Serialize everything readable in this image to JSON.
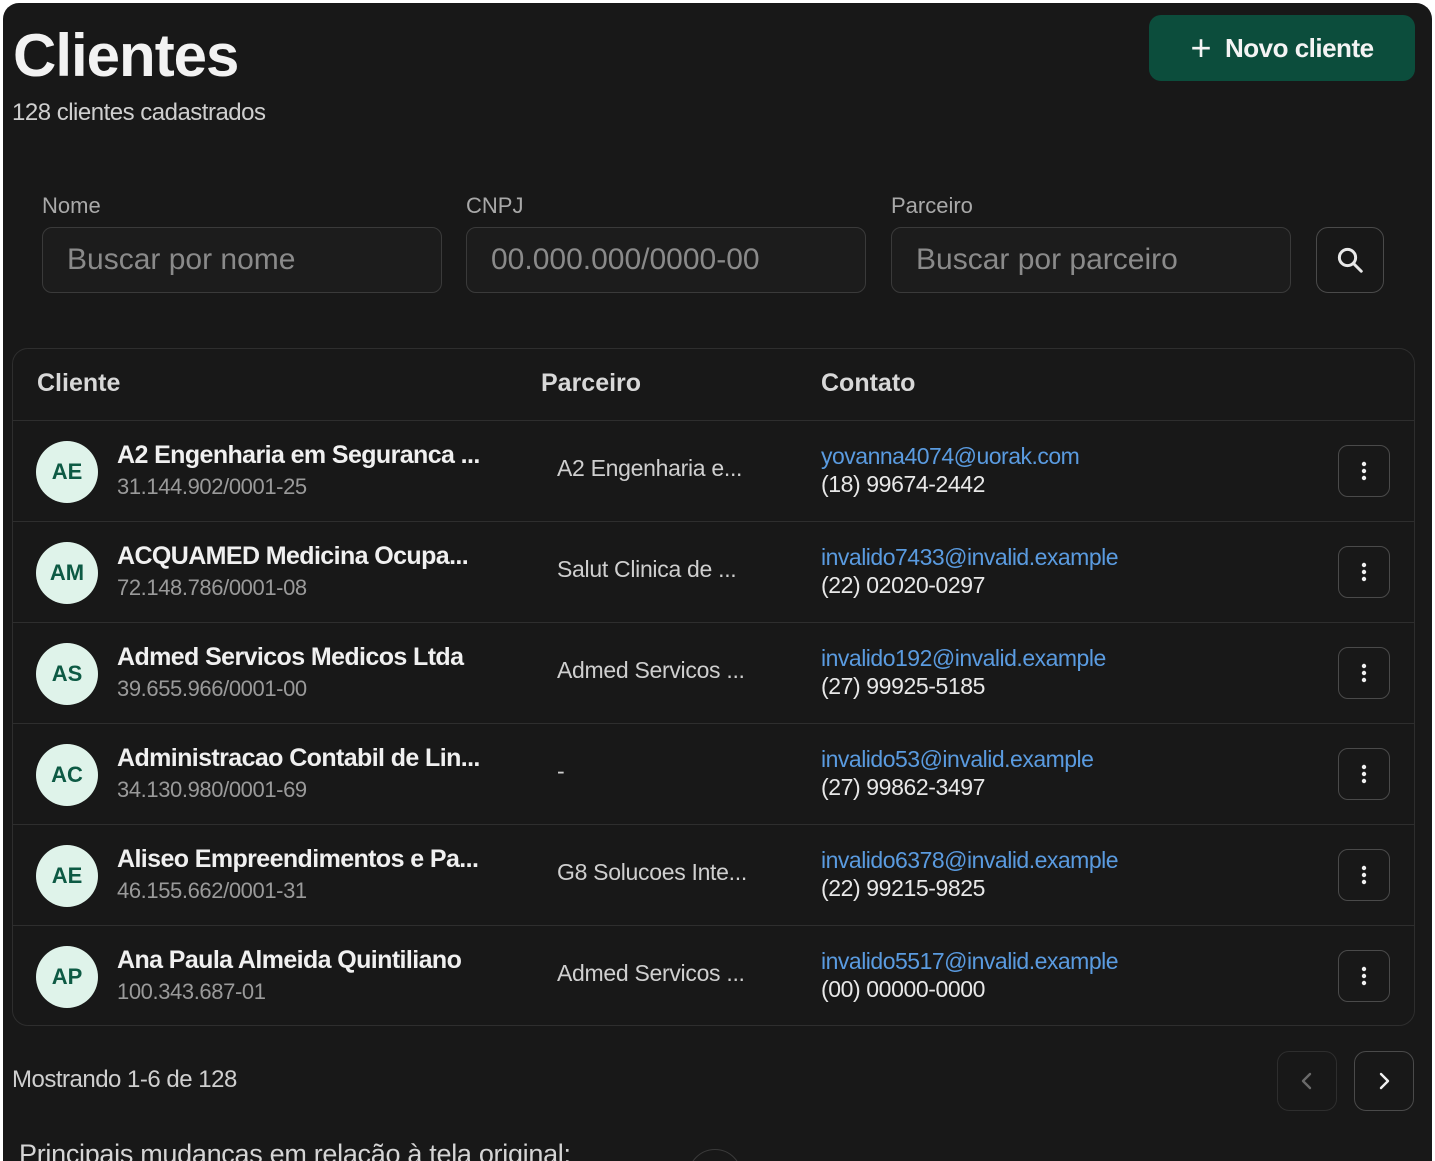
{
  "header": {
    "title": "Clientes",
    "subtitle": "128 clientes cadastrados",
    "new_button_label": "Novo cliente"
  },
  "filters": {
    "nome": {
      "label": "Nome",
      "placeholder": "Buscar por nome"
    },
    "cnpj": {
      "label": "CNPJ",
      "placeholder": "00.000.000/0000-00"
    },
    "parceiro": {
      "label": "Parceiro",
      "placeholder": "Buscar por parceiro"
    }
  },
  "table": {
    "columns": [
      "Cliente",
      "Parceiro",
      "Contato"
    ],
    "rows": [
      {
        "initials": "AE",
        "name": "A2 Engenharia em Seguranca ...",
        "cnpj": "31.144.902/0001-25",
        "partner": "A2 Engenharia e...",
        "email": "yovanna4074@uorak.com",
        "phone": "(18) 99674-2442"
      },
      {
        "initials": "AM",
        "name": "ACQUAMED Medicina Ocupa...",
        "cnpj": "72.148.786/0001-08",
        "partner": "Salut Clinica de ...",
        "email": "invalido7433@invalid.example",
        "phone": "(22) 02020-0297"
      },
      {
        "initials": "AS",
        "name": "Admed Servicos Medicos Ltda",
        "cnpj": "39.655.966/0001-00",
        "partner": "Admed Servicos ...",
        "email": "invalido192@invalid.example",
        "phone": "(27) 99925-5185"
      },
      {
        "initials": "AC",
        "name": "Administracao Contabil de Lin...",
        "cnpj": "34.130.980/0001-69",
        "partner": "-",
        "email": "invalido53@invalid.example",
        "phone": "(27) 99862-3497"
      },
      {
        "initials": "AE",
        "name": "Aliseo Empreendimentos e Pa...",
        "cnpj": "46.155.662/0001-31",
        "partner": "G8 Solucoes Inte...",
        "email": "invalido6378@invalid.example",
        "phone": "(22) 99215-9825"
      },
      {
        "initials": "AP",
        "name": "Ana Paula Almeida Quintiliano",
        "cnpj": "100.343.687-01",
        "partner": "Admed Servicos ...",
        "email": "invalido5517@invalid.example",
        "phone": "(00) 00000-0000"
      }
    ]
  },
  "pagination": {
    "text": "Mostrando 1-6 de 128"
  },
  "bottom_note": "Principais mudanças em relação à tela original:",
  "colors": {
    "background": "#181818",
    "accent_button": "#0c4d3c",
    "avatar_bg": "#dff3ea",
    "avatar_text": "#0d5a44",
    "link": "#5a9be0"
  },
  "icons": [
    "plus-icon",
    "search-icon",
    "more-vertical-icon",
    "chevron-left-icon",
    "chevron-right-icon"
  ]
}
